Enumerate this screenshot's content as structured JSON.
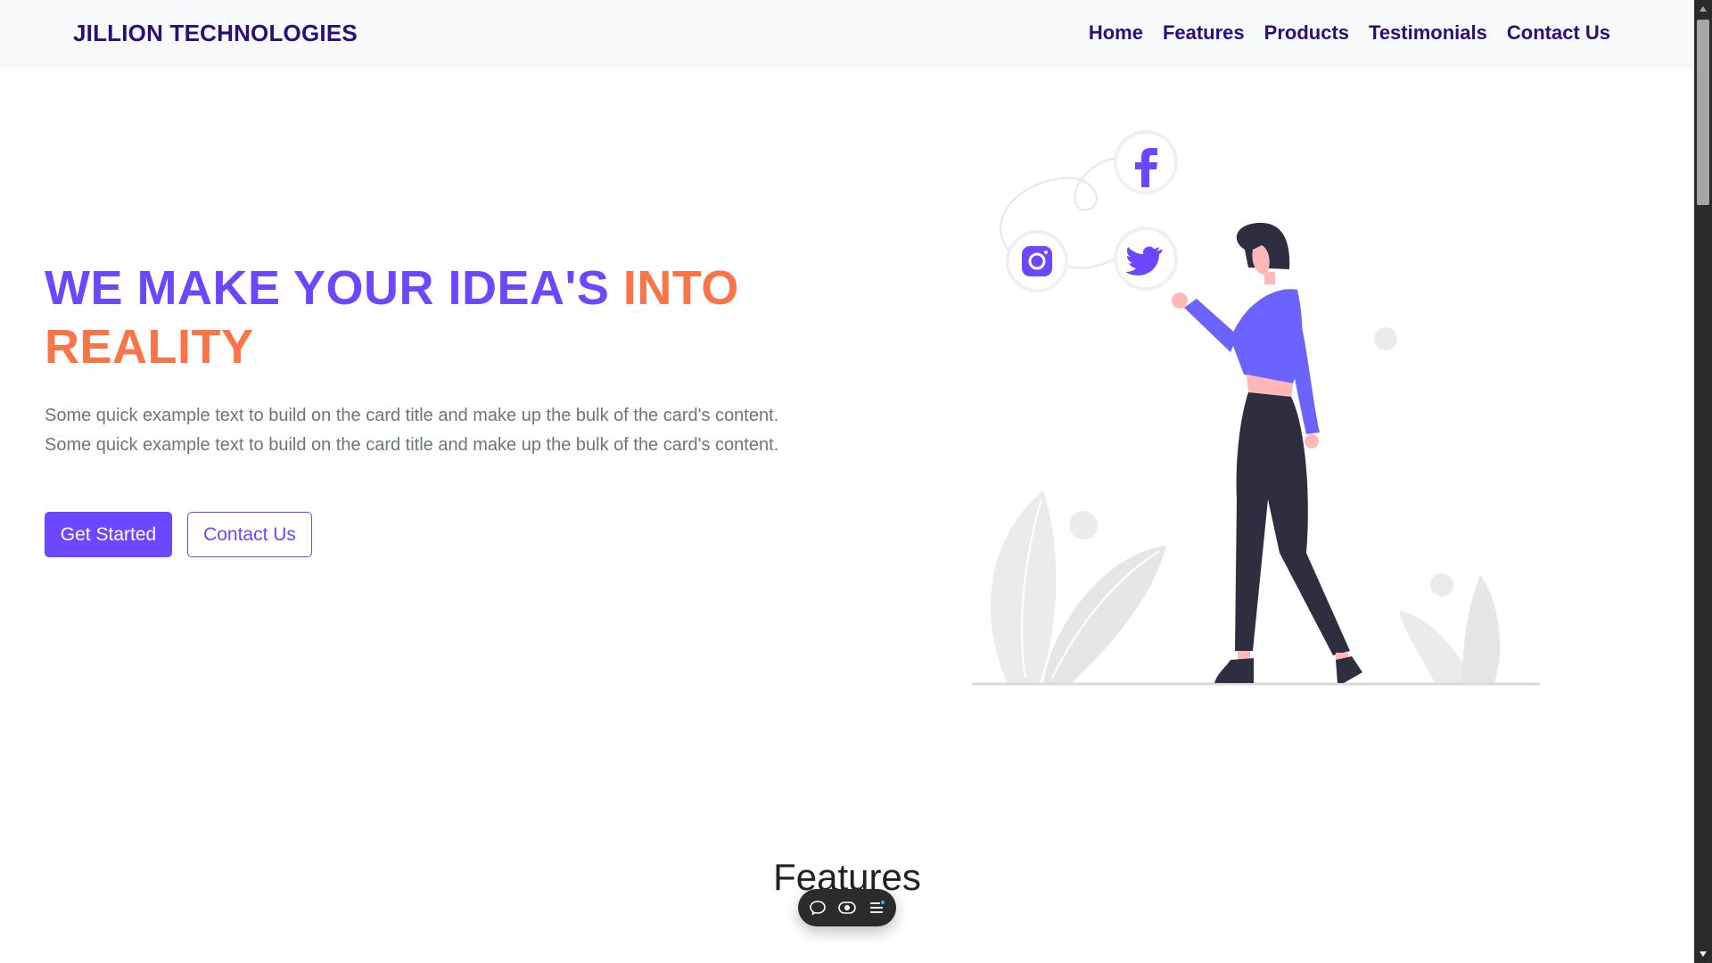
{
  "navbar": {
    "brand": "JILLION TECHNOLOGIES",
    "links": [
      "Home",
      "Features",
      "Products",
      "Testimonials",
      "Contact Us"
    ]
  },
  "hero": {
    "title_part1": "WE MAKE YOUR IDEA'S ",
    "title_part2": "INTO REALITY",
    "text": "Some quick example text to build on the card title and make up the bulk of the card's content. Some quick example text to build on the card title and make up the bulk of the card's content.",
    "primary_button": "Get Started",
    "secondary_button": "Contact Us"
  },
  "illustration": {
    "icons": [
      "facebook-icon",
      "twitter-icon",
      "instagram-icon"
    ]
  },
  "features": {
    "title": "Features"
  },
  "floating_toolbar": {
    "icons": [
      "chat-bubble-icon",
      "eye-icon",
      "menu-icon"
    ]
  },
  "colors": {
    "brand": "#2c0e7a",
    "accent_purple": "#6c47ff",
    "accent_orange": "#fb7447"
  }
}
